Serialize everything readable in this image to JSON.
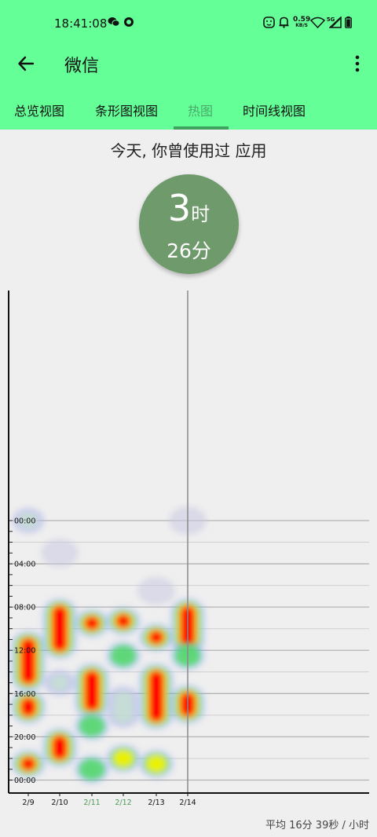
{
  "status_bar": {
    "time": "18:41:08",
    "net_speed": "0.59",
    "net_unit": "KB/S",
    "net_type": "5G",
    "icons": [
      "wechat-icon",
      "app-o-icon",
      "face-icon",
      "bell-off-icon",
      "wifi-icon",
      "signal-icon",
      "battery-icon"
    ]
  },
  "toolbar": {
    "back_icon": "arrow-back-icon",
    "title": "微信",
    "more_icon": "more-vert-icon"
  },
  "tabs": [
    {
      "label": "总览视图",
      "active": false
    },
    {
      "label": "条形图视图",
      "active": false
    },
    {
      "label": "热图",
      "active": true
    },
    {
      "label": "时间线视图",
      "active": false
    }
  ],
  "summary": {
    "subtitle": "今天, 你曾使用过 应用",
    "hours": "3",
    "hours_unit": "时",
    "minutes": "26分"
  },
  "colors": {
    "header": "#64ff97",
    "accent": "#3ea35f",
    "circle": "#6f9a6c",
    "heat_hot": "#ff0000",
    "heat_mid": "#f2f200",
    "heat_low": "#4cd964",
    "heat_cold": "#6b6bff"
  },
  "chart_data": {
    "type": "heatmap",
    "x_categories": [
      "2/9",
      "2/10",
      "2/11",
      "2/12",
      "2/13",
      "2/14"
    ],
    "weekend_days": [
      "2/11",
      "2/12"
    ],
    "y_labels": [
      "00:00",
      "04:00",
      "08:00",
      "12:00",
      "16:00",
      "20:00",
      "00:00"
    ],
    "y_range_hours": [
      0,
      24
    ],
    "current_day": "2/14",
    "spots": [
      {
        "day": "2/9",
        "start": 0,
        "end": 0,
        "level": 0.2
      },
      {
        "day": "2/9",
        "start": 11.5,
        "end": 14.5,
        "level": 1.0
      },
      {
        "day": "2/9",
        "start": 17,
        "end": 17.5,
        "level": 0.95
      },
      {
        "day": "2/9",
        "start": 22.5,
        "end": 22.5,
        "level": 0.75
      },
      {
        "day": "2/10",
        "start": 3,
        "end": 3,
        "level": 0.05
      },
      {
        "day": "2/10",
        "start": 8.5,
        "end": 11.5,
        "level": 1.0
      },
      {
        "day": "2/10",
        "start": 15,
        "end": 15,
        "level": 0.15
      },
      {
        "day": "2/10",
        "start": 20.5,
        "end": 21.5,
        "level": 1.0
      },
      {
        "day": "2/11",
        "start": 9.5,
        "end": 9.5,
        "level": 0.85
      },
      {
        "day": "2/11",
        "start": 14.5,
        "end": 17,
        "level": 1.0
      },
      {
        "day": "2/11",
        "start": 19,
        "end": 19,
        "level": 0.35
      },
      {
        "day": "2/11",
        "start": 23,
        "end": 23,
        "level": 0.4
      },
      {
        "day": "2/12",
        "start": 9.3,
        "end": 9.3,
        "level": 0.8
      },
      {
        "day": "2/12",
        "start": 12.5,
        "end": 12.5,
        "level": 0.4
      },
      {
        "day": "2/12",
        "start": 16.5,
        "end": 18,
        "level": 0.15
      },
      {
        "day": "2/12",
        "start": 22,
        "end": 22,
        "level": 0.5
      },
      {
        "day": "2/13",
        "start": 6.5,
        "end": 6.5,
        "level": 0.05
      },
      {
        "day": "2/13",
        "start": 10.8,
        "end": 10.8,
        "level": 0.95
      },
      {
        "day": "2/13",
        "start": 14.5,
        "end": 18,
        "level": 1.0
      },
      {
        "day": "2/13",
        "start": 22.5,
        "end": 22.5,
        "level": 0.5
      },
      {
        "day": "2/14",
        "start": 0,
        "end": 0,
        "level": 0.05
      },
      {
        "day": "2/14",
        "start": 8.5,
        "end": 11,
        "level": 0.95
      },
      {
        "day": "2/14",
        "start": 12.5,
        "end": 12.5,
        "level": 0.3
      },
      {
        "day": "2/14",
        "start": 16.5,
        "end": 17.5,
        "level": 1.0
      }
    ]
  },
  "footer": {
    "average": "平均 16分 39秒 / 小时"
  }
}
